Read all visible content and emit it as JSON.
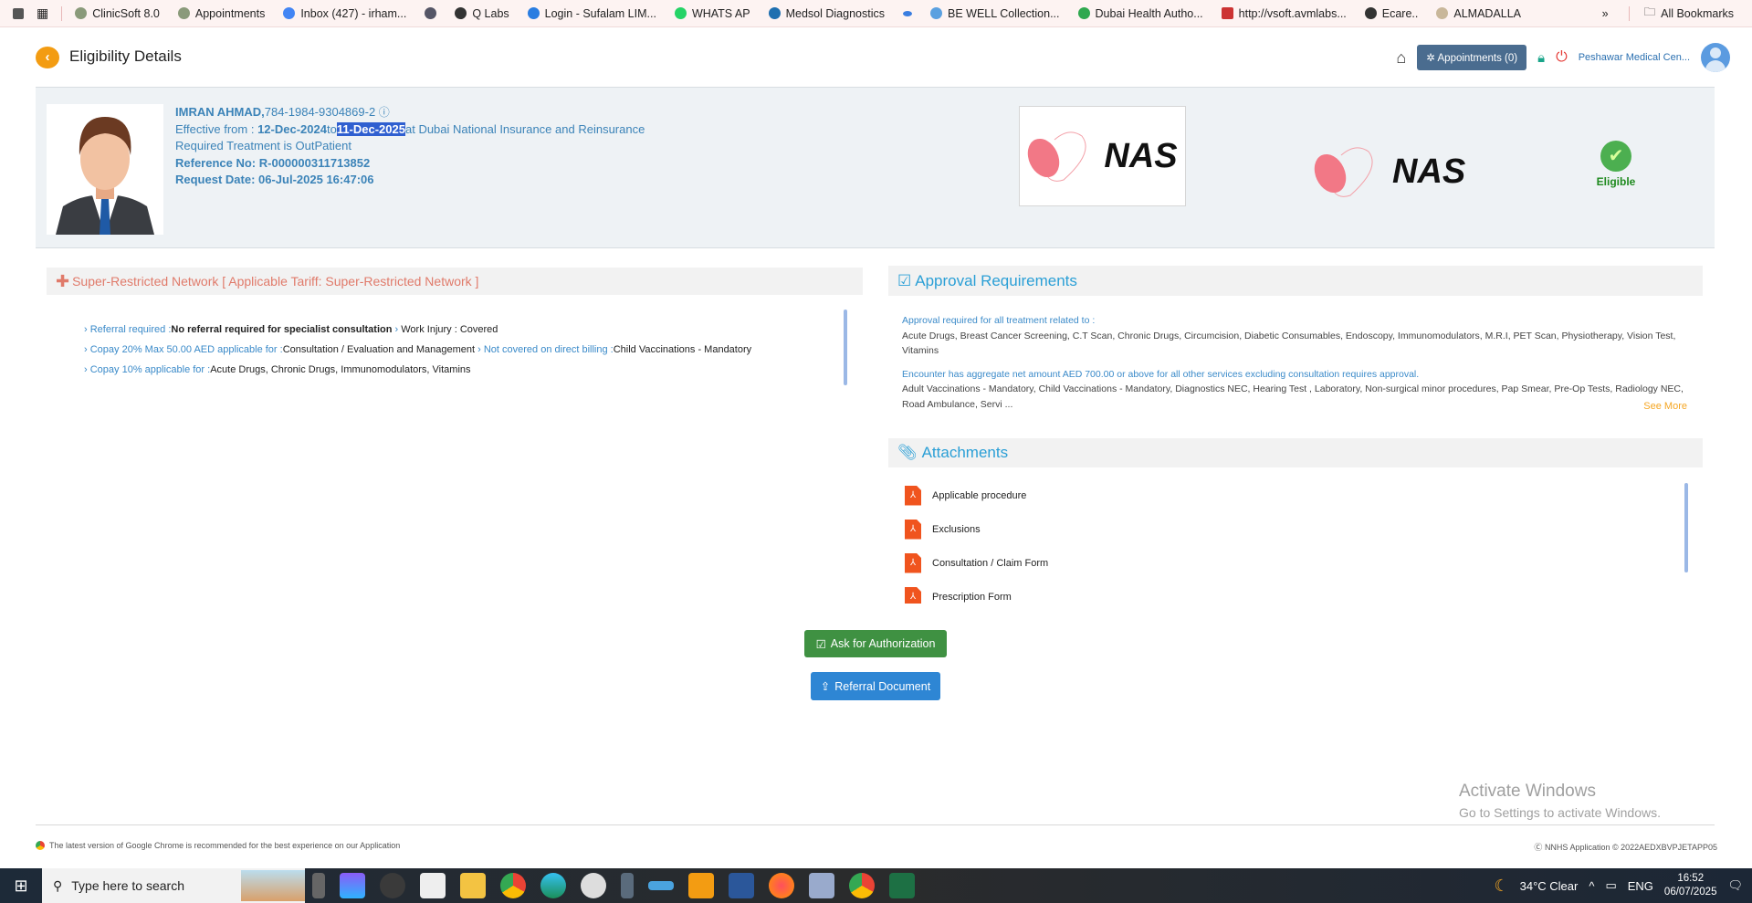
{
  "bookmarks": [
    "ClinicSoft 8.0",
    "Appointments",
    "Inbox (427) - irham...",
    "",
    "Q Labs",
    "Login - Sufalam LIM...",
    "WHATS AP",
    "Medsol Diagnostics",
    "",
    "BE WELL Collection...",
    "Dubai Health Autho...",
    "http://vsoft.avmlabs...",
    "Ecare..",
    "ALMADALLA"
  ],
  "all_bookmarks": "All Bookmarks",
  "header": {
    "title": "Eligibility Details",
    "appointments": "Appointments (0)",
    "facility": "Peshawar Medical Cen..."
  },
  "patient": {
    "name": "IMRAN AHMAD,",
    "id": "784-1984-9304869-2",
    "effective_label": "Effective from : ",
    "from": "12-Dec-2024",
    "to_word": "to",
    "to": "11-Dec-2025",
    "insurer": "at Dubai National Insurance and Reinsurance",
    "treatment": "Required Treatment is OutPatient",
    "reference": "Reference No: R-000000311713852",
    "request_date": "Request Date: 06-Jul-2025 16:47:06"
  },
  "logo_text": "NAS",
  "status": "Eligible",
  "network": {
    "title": "Super-Restricted Network [ Applicable Tariff: Super-Restricted Network ]",
    "items": [
      {
        "k1": "Referral required :",
        "v1": "No referral required for specialist consultation",
        "k2": "",
        "v2": "Work Injury : Covered"
      },
      {
        "k1": "Copay 20% Max 50.00 AED applicable for :",
        "v1": "Consultation / Evaluation and Management",
        "k2": "Not covered on direct billing :",
        "v2": "Child Vaccinations - Mandatory"
      },
      {
        "k1": "Copay 10% applicable for :",
        "v1": "Acute Drugs, Chronic Drugs, Immunomodulators, Vitamins"
      }
    ]
  },
  "approval": {
    "title": "Approval Requirements",
    "h1": "Approval required for all treatment related to :",
    "t1": "Acute Drugs, Breast Cancer Screening, C.T Scan, Chronic Drugs, Circumcision, Diabetic Consumables, Endoscopy, Immunomodulators, M.R.I, PET Scan, Physiotherapy, Vision Test, Vitamins",
    "h2": "Encounter has aggregate net amount AED 700.00 or above for all other services excluding consultation requires approval.",
    "t2": "Adult Vaccinations - Mandatory, Child Vaccinations - Mandatory, Diagnostics NEC, Hearing Test , Laboratory, Non-surgical minor procedures, Pap Smear, Pre-Op Tests, Radiology NEC, Road Ambulance, Servi ...",
    "see_more": "See More"
  },
  "attachments": {
    "title": "Attachments",
    "items": [
      "Applicable procedure",
      "Exclusions",
      "Consultation / Claim Form",
      "Prescription Form"
    ]
  },
  "buttons": {
    "authorize": "Ask for Authorization",
    "referral": "Referral Document"
  },
  "watermark": {
    "l1": "Activate Windows",
    "l2": "Go to Settings to activate Windows."
  },
  "footer": {
    "left": "The latest version of Google Chrome is recommended for the best experience on our Application",
    "right": "NNHS Application © 2022AEDXBVPJETAPP05"
  },
  "taskbar": {
    "search": "Type here to search",
    "weather": "34°C  Clear",
    "lang": "ENG",
    "time": "16:52",
    "date": "06/07/2025"
  },
  "colors": {
    "accent": "#3a8ac9",
    "network": "#e07a6a",
    "eligible": "#4caf50",
    "authorize": "#3f9142",
    "referral": "#2e86d4"
  }
}
